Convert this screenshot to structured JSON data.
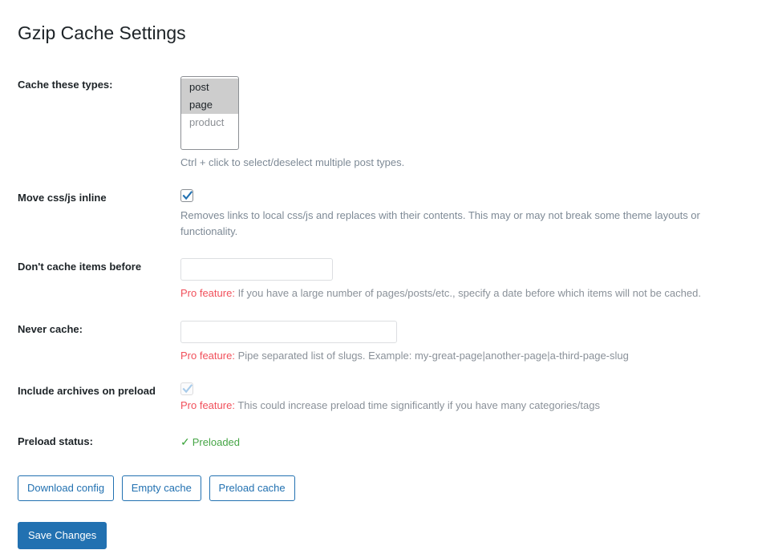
{
  "page": {
    "title": "Gzip Cache Settings"
  },
  "fields": {
    "cache_types": {
      "label": "Cache these types:",
      "options": [
        {
          "value": "post",
          "selected": true
        },
        {
          "value": "page",
          "selected": true
        },
        {
          "value": "product",
          "selected": false
        }
      ],
      "help": "Ctrl + click to select/deselect multiple post types."
    },
    "move_inline": {
      "label": "Move css/js inline",
      "checked": true,
      "enabled": true,
      "help": "Removes links to local css/js and replaces with their contents. This may or may not break some theme layouts or functionality."
    },
    "dont_cache_before": {
      "label": "Don't cache items before",
      "value": "",
      "placeholder": "",
      "pro_label": "Pro feature:",
      "help": "If you have a large number of pages/posts/etc., specify a date before which items will not be cached."
    },
    "never_cache": {
      "label": "Never cache:",
      "value": "",
      "placeholder": "",
      "pro_label": "Pro feature:",
      "help": "Pipe separated list of slugs. Example: my-great-page|another-page|a-third-page-slug"
    },
    "include_archives": {
      "label": "Include archives on preload",
      "checked": true,
      "enabled": false,
      "pro_label": "Pro feature:",
      "help": "This could increase preload time significantly if you have many categories/tags"
    },
    "preload_status": {
      "label": "Preload status:",
      "tick": "✓",
      "value": "Preloaded"
    }
  },
  "actions": {
    "download_config": "Download config",
    "empty_cache": "Empty cache",
    "preload_cache": "Preload cache",
    "save_changes": "Save Changes"
  },
  "colors": {
    "primary": "#2271b1",
    "pro_red": "#f1505b",
    "status_green": "#46a546",
    "muted": "#7e8a96"
  }
}
